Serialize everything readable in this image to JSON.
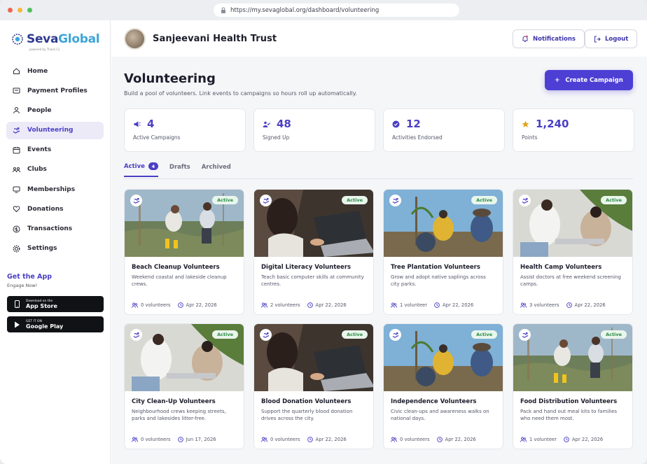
{
  "browser": {
    "url": "https://my.sevaglobal.org/dashboard/volunteering"
  },
  "brand": {
    "name_part1": "Seva",
    "name_part2": "Global",
    "powered_by": "powered by Thank Co"
  },
  "sidebar": {
    "items": [
      {
        "label": "Home",
        "icon": "home-icon"
      },
      {
        "label": "Payment Profiles",
        "icon": "payment-icon"
      },
      {
        "label": "People",
        "icon": "people-icon"
      },
      {
        "label": "Volunteering",
        "icon": "volunteer-icon",
        "active": true
      },
      {
        "label": "Events",
        "icon": "calendar-icon"
      },
      {
        "label": "Clubs",
        "icon": "clubs-icon"
      },
      {
        "label": "Memberships",
        "icon": "membership-icon"
      },
      {
        "label": "Donations",
        "icon": "heart-icon"
      },
      {
        "label": "Transactions",
        "icon": "dollar-icon"
      },
      {
        "label": "Settings",
        "icon": "gear-icon"
      }
    ],
    "get_app": {
      "title": "Get the App",
      "subtitle": "Engage Now!"
    },
    "app_store": {
      "small": "Download on the",
      "big": "App Store"
    },
    "google_play": {
      "small": "GET IT ON",
      "big": "Google Play"
    }
  },
  "header": {
    "org_name": "Sanjeevani Health Trust",
    "notifications_label": "Notifications",
    "logout_label": "Logout"
  },
  "page": {
    "title": "Volunteering",
    "subtitle": "Build a pool of volunteers. Link events to campaigns so hours roll up automatically.",
    "create_label": "Create Campaign"
  },
  "stats": [
    {
      "value": "4",
      "label": "Active Campaigns",
      "icon": "megaphone-icon"
    },
    {
      "value": "48",
      "label": "Signed Up",
      "icon": "user-check-icon"
    },
    {
      "value": "12",
      "label": "Activities Endorsed",
      "icon": "badge-check-icon"
    },
    {
      "value": "1,240",
      "label": "Points",
      "icon": "star-icon"
    }
  ],
  "tabs": [
    {
      "label": "Active",
      "count": "4",
      "active": true
    },
    {
      "label": "Drafts"
    },
    {
      "label": "Archived"
    }
  ],
  "cards": [
    {
      "title": "Beach Cleanup Volunteers",
      "desc": "Weekend coastal and lakeside cleanup crews.",
      "volunteers": "0 volunteers",
      "date": "Apr 22, 2026",
      "badge": "Active",
      "scene": "lake"
    },
    {
      "title": "Digital Literacy Volunteers",
      "desc": "Teach basic computer skills at community centres.",
      "volunteers": "2 volunteers",
      "date": "Apr 22, 2026",
      "badge": "Active",
      "scene": "laptop"
    },
    {
      "title": "Tree Plantation Volunteers",
      "desc": "Grow and adopt native saplings across city parks.",
      "volunteers": "1 volunteer",
      "date": "Apr 22, 2026",
      "badge": "Active",
      "scene": "tree"
    },
    {
      "title": "Health Camp Volunteers",
      "desc": "Assist doctors at free weekend screening camps.",
      "volunteers": "3 volunteers",
      "date": "Apr 22, 2026",
      "badge": "Active",
      "scene": "health"
    },
    {
      "title": "City Clean-Up Volunteers",
      "desc": "Neighbourhood crews keeping streets, parks and lakesides litter-free.",
      "volunteers": "0 volunteers",
      "date": "Jun 17, 2026",
      "badge": "Active",
      "scene": "health"
    },
    {
      "title": "Blood Donation Volunteers",
      "desc": "Support the quarterly blood donation drives across the city.",
      "volunteers": "0 volunteers",
      "date": "Apr 22, 2026",
      "badge": "Active",
      "scene": "laptop"
    },
    {
      "title": "Independence Volunteers",
      "desc": "Civic clean-ups and awareness walks on national days.",
      "volunteers": "0 volunteers",
      "date": "Apr 22, 2026",
      "badge": "Active",
      "scene": "tree"
    },
    {
      "title": "Food Distribution Volunteers",
      "desc": "Pack and hand out meal kits to families who need them most.",
      "volunteers": "1 volunteer",
      "date": "Apr 22, 2026",
      "badge": "Active",
      "scene": "lake"
    }
  ],
  "colors": {
    "accent": "#4b3fc4",
    "active_badge_bg": "#e9f6ec",
    "active_badge_text": "#2c8a45"
  }
}
